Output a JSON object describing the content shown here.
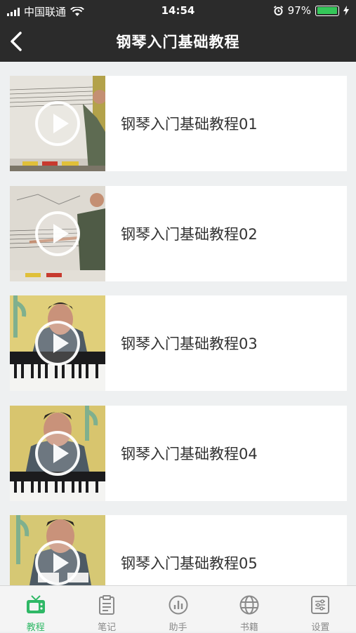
{
  "status_bar": {
    "carrier": "中国联通",
    "time": "14:54",
    "battery": "97%",
    "battery_level": 0.97
  },
  "nav": {
    "title": "钢琴入门基础教程",
    "back_icon": "chevron-left-icon"
  },
  "lessons": [
    {
      "title": "钢琴入门基础教程01"
    },
    {
      "title": "钢琴入门基础教程02"
    },
    {
      "title": "钢琴入门基础教程03"
    },
    {
      "title": "钢琴入门基础教程04"
    },
    {
      "title": "钢琴入门基础教程05"
    }
  ],
  "tabs": [
    {
      "label": "教程",
      "icon": "tv-icon",
      "active": true
    },
    {
      "label": "笔记",
      "icon": "clipboard-icon",
      "active": false
    },
    {
      "label": "助手",
      "icon": "chart-icon",
      "active": false
    },
    {
      "label": "书籍",
      "icon": "globe-icon",
      "active": false
    },
    {
      "label": "设置",
      "icon": "sliders-icon",
      "active": false
    }
  ],
  "colors": {
    "header_bg": "#2b2b2b",
    "accent": "#2fb866",
    "page_bg": "#eef0f1"
  }
}
